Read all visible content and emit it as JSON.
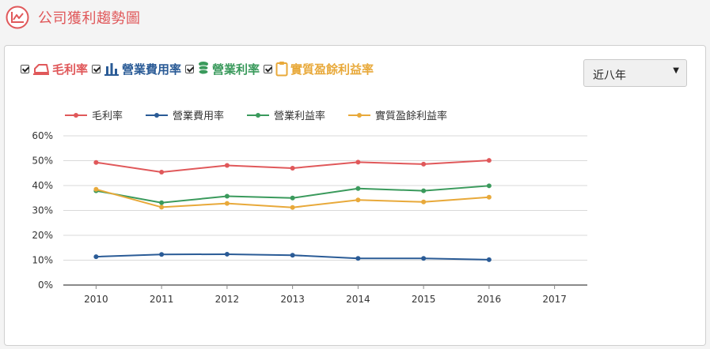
{
  "header": {
    "title": "公司獲利趨勢圖",
    "icon": "line-chart-icon",
    "accent": "#e0585a"
  },
  "toggles": [
    {
      "label": "毛利率",
      "checked": true,
      "color": "#e0585a",
      "icon": "area-chart-icon"
    },
    {
      "label": "營業費用率",
      "checked": true,
      "color": "#2a5b96",
      "icon": "bar-chart-icon"
    },
    {
      "label": "營業利率",
      "checked": true,
      "color": "#3a9a5c",
      "icon": "coins-icon"
    },
    {
      "label": "實質盈餘利益率",
      "checked": true,
      "color": "#e8a93a",
      "icon": "clipboard-icon"
    }
  ],
  "range_select": {
    "value": "近八年"
  },
  "chart_data": {
    "type": "line",
    "categories": [
      "2010",
      "2011",
      "2012",
      "2013",
      "2014",
      "2015",
      "2016",
      "2017"
    ],
    "yticks": [
      "0%",
      "10%",
      "20%",
      "30%",
      "40%",
      "50%",
      "60%"
    ],
    "ylim": [
      0,
      60
    ],
    "grid": true,
    "legend_position": "top-left",
    "series": [
      {
        "name": "毛利率",
        "color": "#e0585a",
        "values": [
          49.3,
          45.4,
          48.1,
          47.0,
          49.4,
          48.6,
          50.1,
          null
        ]
      },
      {
        "name": "營業費用率",
        "color": "#2a5b96",
        "values": [
          11.4,
          12.3,
          12.4,
          12.0,
          10.7,
          10.7,
          10.2,
          null
        ]
      },
      {
        "name": "營業利益率",
        "color": "#3a9a5c",
        "values": [
          37.9,
          33.1,
          35.7,
          35.0,
          38.8,
          37.9,
          39.9,
          null
        ]
      },
      {
        "name": "實質盈餘利益率",
        "color": "#e8a93a",
        "values": [
          38.5,
          31.3,
          32.8,
          31.2,
          34.2,
          33.4,
          35.3,
          null
        ]
      }
    ]
  }
}
